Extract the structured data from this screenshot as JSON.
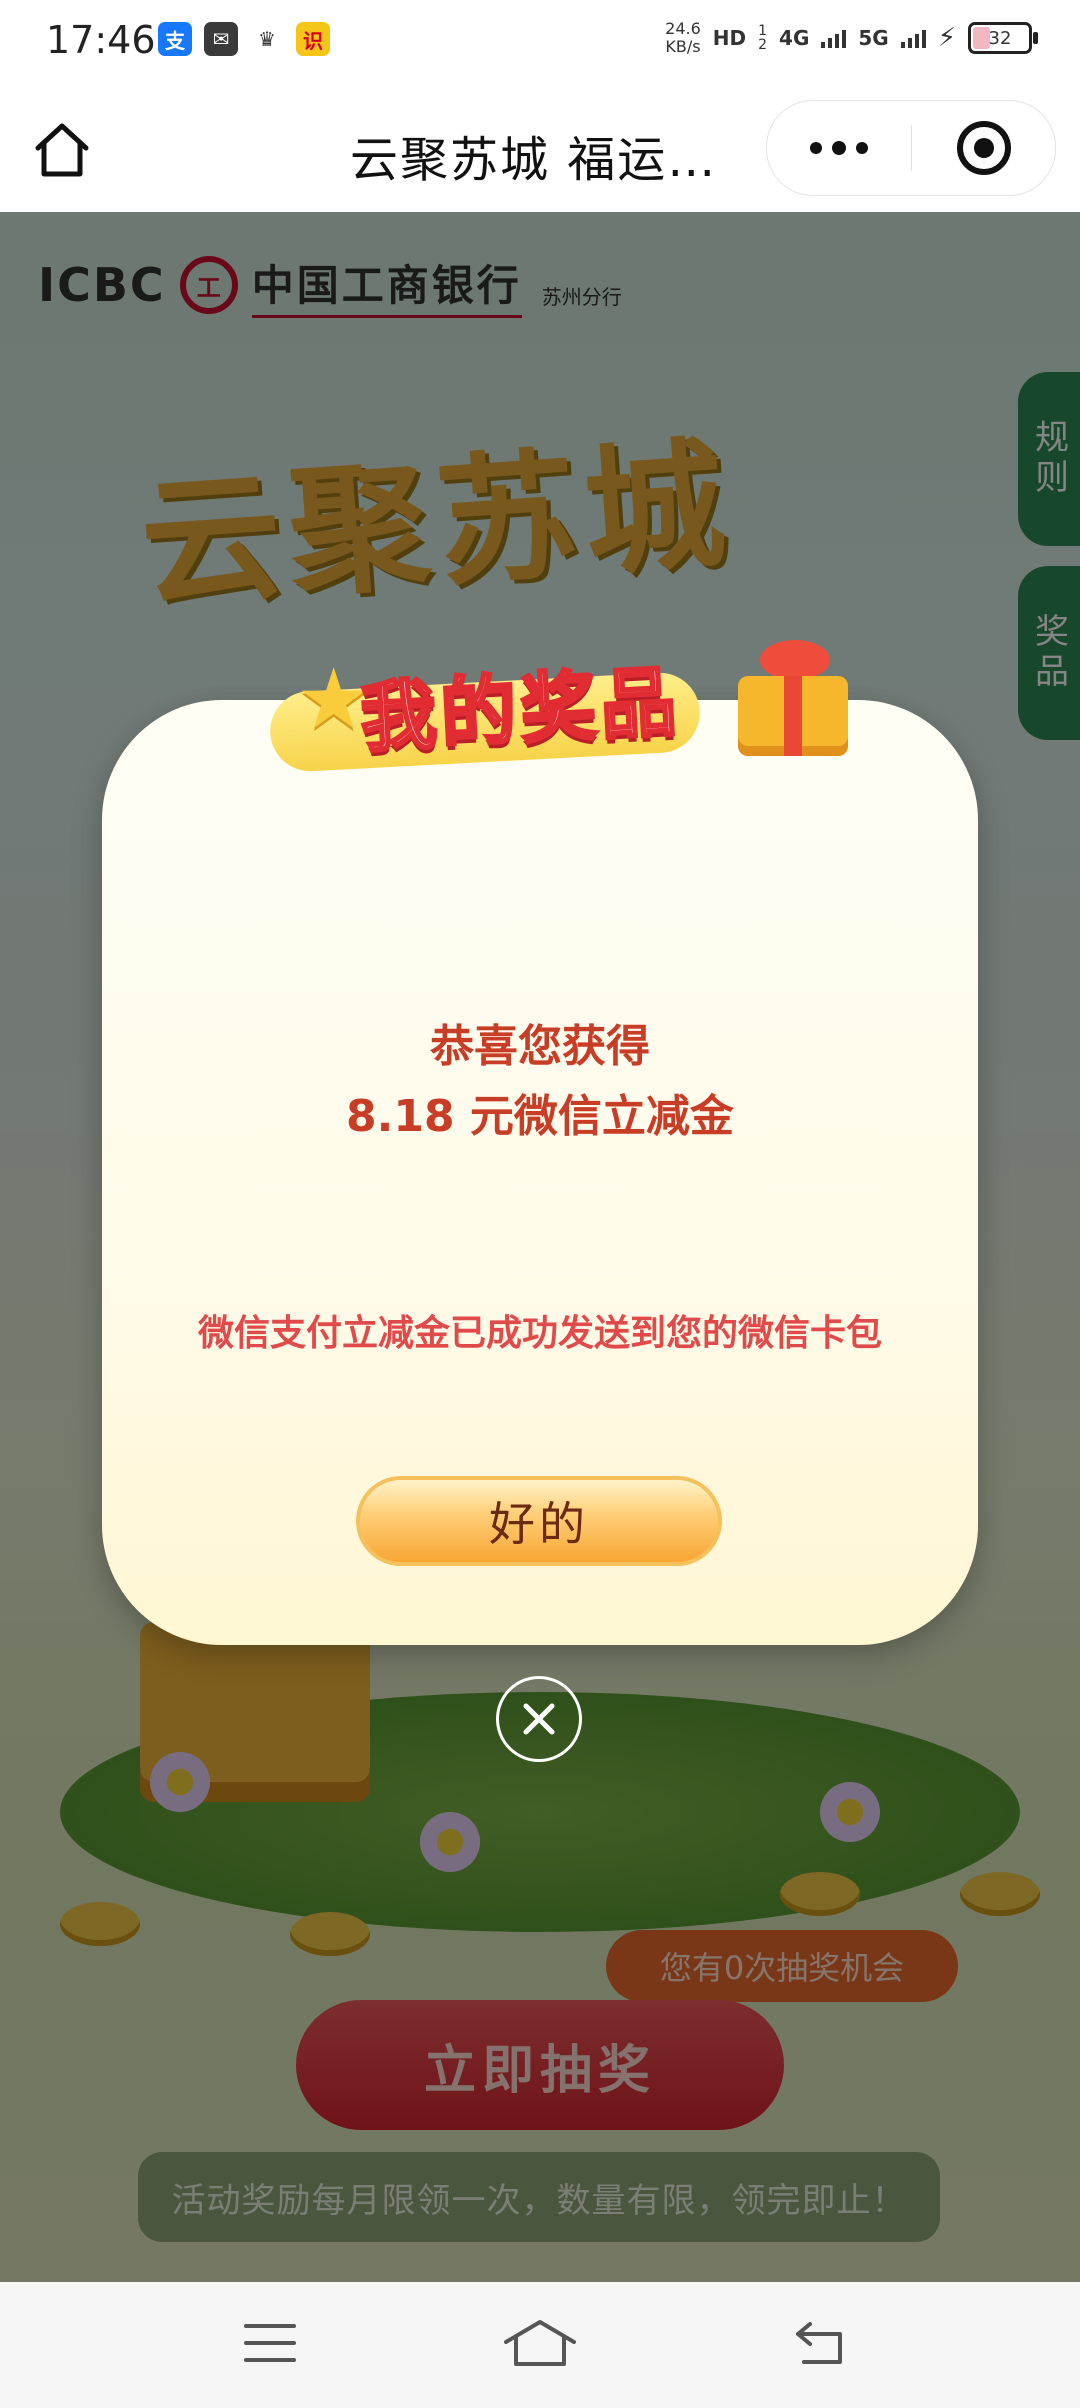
{
  "status_bar": {
    "time": "17:46",
    "apps": [
      {
        "name": "alipay-icon",
        "glyph": "支",
        "bg": "#1677ff",
        "fg": "#ffffff"
      },
      {
        "name": "mail-icon",
        "glyph": "✉",
        "bg": "#3a3a3a",
        "fg": "#ffffff"
      },
      {
        "name": "crown-icon",
        "glyph": "♛",
        "bg": "transparent",
        "fg": "#333333"
      },
      {
        "name": "quiz-app-icon",
        "glyph": "识",
        "bg": "#f5c518",
        "fg": "#d6001c"
      }
    ],
    "speed_value": "24.6",
    "speed_unit": "KB/s",
    "hd_label": "HD",
    "sim1": "1",
    "sim2": "2",
    "net1": "4G",
    "net2": "5G",
    "battery": "32",
    "battery_level": 0.32
  },
  "title_bar": {
    "title": "云聚苏城 福运…"
  },
  "background": {
    "bank_en": "ICBC",
    "bank_logo": "工",
    "bank_cn": "中国工商银行",
    "bank_branch": "苏州分行",
    "side_tab_rules": "规则",
    "side_tab_prizes": "奖品",
    "hero_title": "云聚苏城",
    "chance_text": "您有0次抽奖机会",
    "draw_button": "立即抽奖",
    "notice": "活动奖励每月限领一次，数量有限，领完即止！"
  },
  "modal": {
    "banner_title": "我的奖品",
    "congrats_line1": "恭喜您获得",
    "congrats_line2": "8.18 元微信立减金",
    "sent_message": "微信支付立减金已成功发送到您的微信卡包",
    "ok_button": "好的"
  },
  "colors": {
    "accent_red": "#c73d26",
    "brand_red": "#c8102e",
    "button_orange": "#f8a634"
  }
}
